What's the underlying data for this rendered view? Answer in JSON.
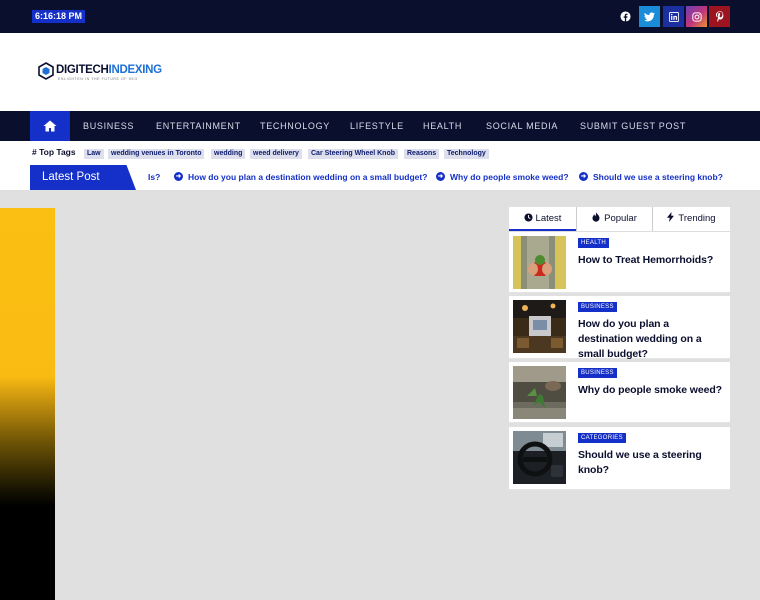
{
  "topbar": {
    "time": "6:16:18 PM",
    "social": [
      {
        "name": "facebook-icon",
        "glyph": "●",
        "color": "#0b0f2e"
      },
      {
        "name": "twitter-icon",
        "glyph": "✦",
        "color": "#1a8cd8"
      },
      {
        "name": "linkedin-icon",
        "glyph": "in",
        "color": "#1b2fa0"
      },
      {
        "name": "instagram-icon",
        "glyph": "◎",
        "color": "#b43a8f"
      },
      {
        "name": "pinterest-icon",
        "glyph": "P",
        "color": "#9c1420"
      }
    ]
  },
  "logo": {
    "part1": "DIGITECH",
    "part2": "INDEXING",
    "tagline": "ENLIGHTEN IN THE FUTURE OF SEO"
  },
  "nav": {
    "items": [
      "BUSINESS",
      "ENTERTAINMENT",
      "TECHNOLOGY",
      "LIFESTYLE",
      "HEALTH",
      "SOCIAL MEDIA",
      "SUBMIT GUEST POST"
    ]
  },
  "toptags": {
    "label": "# Top Tags",
    "tags": [
      "Law",
      "wedding venues in Toronto",
      "wedding",
      "weed delivery",
      "Car Steering Wheel Knob",
      "Reasons",
      "Technology"
    ]
  },
  "latest": {
    "label": "Latest Post",
    "ticker": [
      "Is?",
      "How do you plan a destination wedding on a small budget?",
      "Why do people smoke weed?",
      "Should we use a steering knob?"
    ]
  },
  "widget": {
    "tabs": [
      "Latest",
      "Popular",
      "Trending"
    ],
    "posts": [
      {
        "category": "HEALTH",
        "title": "How to Treat Hemorrhoids?"
      },
      {
        "category": "BUSINESS",
        "title": "How do you plan a destination wedding on a small budget?"
      },
      {
        "category": "BUSINESS",
        "title": "Why do people smoke weed?"
      },
      {
        "category": "CATEGORIES",
        "title": "Should we use a steering knob?"
      }
    ]
  }
}
